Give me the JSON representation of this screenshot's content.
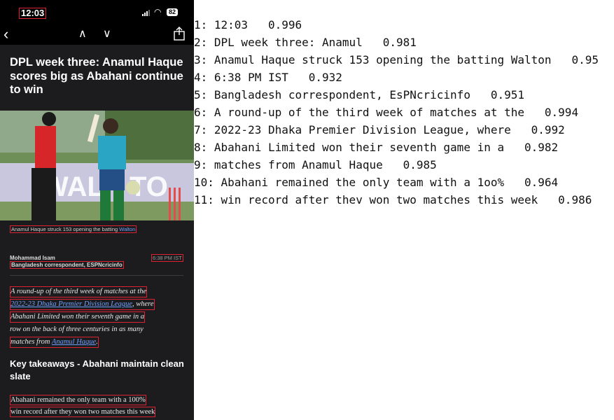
{
  "status_bar": {
    "time": "12:03",
    "battery": "82"
  },
  "nav": {
    "back": "‹",
    "up": "∧",
    "down": "∨"
  },
  "article": {
    "headline": "DPL week three: Anamul Haque scores big as Abahani continue to win",
    "image_caption_text": "Anamul Haque struck 153 opening the batting ",
    "image_caption_link": "Walton",
    "author_name": "Mohammad Isam",
    "author_role": "Bangladesh correspondent, ESPNcricinfo",
    "published": "6:38 PM IST",
    "intro_line1": "A round-up of the third week of matches at the",
    "intro_line2_link": "2022-23 Dhaka Premier Division League",
    "intro_line2_tail": ", where",
    "intro_line3": "Abahani Limited won their seventh game in a",
    "intro_line4": "row on the back of three centuries in as many",
    "intro_line5_text": "matches from ",
    "intro_line5_link": "Anamul Haque",
    "intro_line5_tail": ".",
    "subhead": "Key takeaways - Abahani maintain clean slate",
    "body_line1": "Abahani remained the only team with a 100%",
    "body_line2": "win record after they won two matches this week"
  },
  "ocr_results": [
    {
      "text": "1: 12:03   0.996"
    },
    {
      "text": "2: DPL week three: Anamul   0.981"
    },
    {
      "text": "3: Anamul Haque struck 153 opening the batting Walton   0.95"
    },
    {
      "text": "4: 6:38 PM IST   0.932"
    },
    {
      "text": "5: Bangladesh correspondent, EsPNcricinfo   0.951"
    },
    {
      "text": "6: A round-up of the third week of matches at the   0.994"
    },
    {
      "text": "7: 2022-23 Dhaka Premier Division League, where   0.992"
    },
    {
      "text": "8: Abahani Limited won their seventh game in a   0.982"
    },
    {
      "text": "9: matches from Anamul Haque   0.985"
    },
    {
      "text": "10: Abahani remained the only team with a 1oo%   0.964"
    },
    {
      "text": "11: win record after thev won two matches this week   0.986"
    }
  ],
  "colors": {
    "app_bg": "#1c1c1e",
    "link": "#6ea0ff",
    "box": "#dd2233"
  }
}
